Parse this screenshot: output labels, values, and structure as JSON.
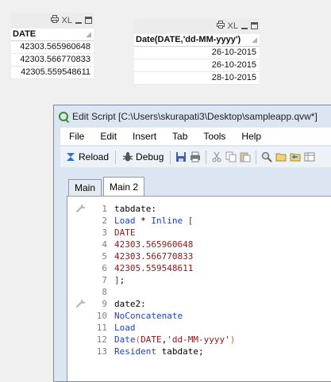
{
  "listbox_date": {
    "print_icon": "print-icon",
    "xl_label": "XL",
    "header": "DATE",
    "rows": [
      "42303.565960648",
      "42303.566770833",
      "42305.559548611"
    ]
  },
  "listbox_formatted": {
    "xl_label": "XL",
    "header": "Date(DATE,'dd-MM-yyyy')",
    "rows": [
      "26-10-2015",
      "26-10-2015",
      "28-10-2015"
    ]
  },
  "window": {
    "title": "Edit Script [C:\\Users\\skurapati3\\Desktop\\sampleapp.qvw*]",
    "menu": [
      "File",
      "Edit",
      "Insert",
      "Tab",
      "Tools",
      "Help"
    ],
    "toolbar": {
      "reload_label": "Reload",
      "debug_label": "Debug"
    },
    "tabs": [
      "Main",
      "Main 2"
    ],
    "active_tab": "Main 2"
  },
  "colors": {
    "keyword": "#1c3fc8",
    "value": "#8b1a1a",
    "line_number": "#7f7f7f",
    "paren": "#c07000"
  },
  "code_lines": [
    {
      "n": "1",
      "marker": true,
      "parts": [
        [
          "t",
          "tabdate:"
        ]
      ]
    },
    {
      "n": "2",
      "marker": false,
      "parts": [
        [
          "k",
          "Load"
        ],
        [
          "t",
          " * "
        ],
        [
          "k",
          "Inline"
        ],
        [
          "t",
          " "
        ],
        [
          "v",
          "["
        ]
      ]
    },
    {
      "n": "3",
      "marker": false,
      "parts": [
        [
          "v",
          "DATE"
        ]
      ]
    },
    {
      "n": "4",
      "marker": false,
      "parts": [
        [
          "v",
          "42303.565960648"
        ]
      ]
    },
    {
      "n": "5",
      "marker": false,
      "parts": [
        [
          "v",
          "42303.566770833"
        ]
      ]
    },
    {
      "n": "6",
      "marker": false,
      "parts": [
        [
          "v",
          "42305.559548611"
        ]
      ]
    },
    {
      "n": "7",
      "marker": false,
      "parts": [
        [
          "v",
          "]"
        ],
        [
          "t",
          ";"
        ]
      ]
    },
    {
      "n": "8",
      "marker": false,
      "parts": []
    },
    {
      "n": "9",
      "marker": true,
      "parts": [
        [
          "t",
          "date2:"
        ]
      ]
    },
    {
      "n": "10",
      "marker": false,
      "parts": [
        [
          "k",
          "NoConcatenate"
        ]
      ]
    },
    {
      "n": "11",
      "marker": false,
      "parts": [
        [
          "k",
          "Load"
        ]
      ]
    },
    {
      "n": "12",
      "marker": false,
      "parts": [
        [
          "k",
          "Date"
        ],
        [
          "p",
          "("
        ],
        [
          "v",
          "DATE"
        ],
        [
          "t",
          ","
        ],
        [
          "s",
          "'dd-MM-yyyy'"
        ],
        [
          "p",
          ")"
        ]
      ]
    },
    {
      "n": "13",
      "marker": false,
      "parts": [
        [
          "k",
          "Resident"
        ],
        [
          "t",
          " tabdate;"
        ]
      ]
    }
  ]
}
